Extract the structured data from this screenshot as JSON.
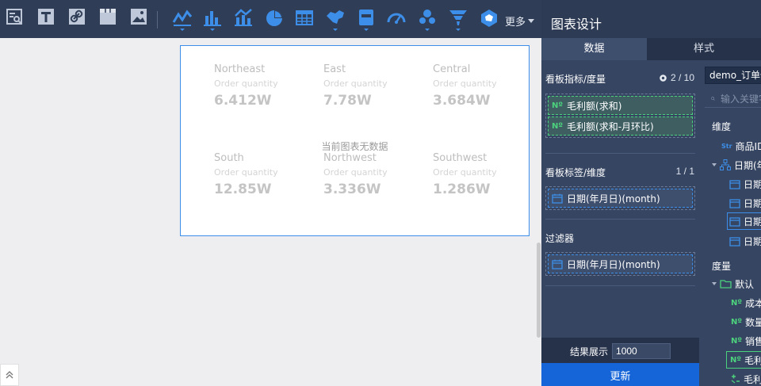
{
  "toolbar": {
    "tools": [
      {
        "id": "query",
        "icon": "query-table-icon",
        "color": "#bfc8d8"
      },
      {
        "id": "text",
        "icon": "text-icon",
        "color": "#bfc8d8"
      },
      {
        "id": "link",
        "icon": "link-icon",
        "color": "#bfc8d8"
      },
      {
        "id": "tab",
        "icon": "tab-icon",
        "color": "#bfc8d8"
      },
      {
        "id": "image",
        "icon": "image-icon",
        "color": "#bfc8d8"
      }
    ],
    "charts": [
      {
        "id": "line",
        "icon": "line-chart-icon"
      },
      {
        "id": "bar",
        "icon": "bar-chart-icon"
      },
      {
        "id": "combo",
        "icon": "combo-chart-icon"
      },
      {
        "id": "pie",
        "icon": "pie-chart-icon"
      },
      {
        "id": "table",
        "icon": "table-chart-icon"
      },
      {
        "id": "map",
        "icon": "map-chart-icon"
      },
      {
        "id": "kpi",
        "icon": "kpi-chart-icon"
      },
      {
        "id": "gauge",
        "icon": "gauge-chart-icon"
      },
      {
        "id": "scatter",
        "icon": "scatter-chart-icon"
      },
      {
        "id": "funnel",
        "icon": "funnel-chart-icon"
      },
      {
        "id": "radar",
        "icon": "radar-chart-icon"
      }
    ],
    "accent": "#3d8ee8",
    "more_label": "更多"
  },
  "canvas": {
    "kpis": [
      {
        "name": "Northeast",
        "sub": "Order quantity",
        "value": "6.412W"
      },
      {
        "name": "East",
        "sub": "Order quantity",
        "value": "7.78W"
      },
      {
        "name": "Central",
        "sub": "Order quantity",
        "value": "3.684W"
      },
      {
        "name": "South",
        "sub": "Order quantity",
        "value": "12.85W"
      },
      {
        "name": "Northwest",
        "sub": "Order quantity",
        "value": "3.336W"
      },
      {
        "name": "Southwest",
        "sub": "Order quantity",
        "value": "1.286W"
      }
    ],
    "no_data_text": "当前图表无数据"
  },
  "panel": {
    "title": "图表设计",
    "tabs": {
      "data": "数据",
      "style": "样式"
    },
    "measures": {
      "title": "看板指标/度量",
      "count": "2 / 10",
      "items": [
        "毛利额(求和)",
        "毛利额(求和-月环比)"
      ],
      "number_tag": "Nº"
    },
    "dimensions": {
      "title": "看板标签/维度",
      "count": "1 / 1",
      "items": [
        "日期(年月日)(month)"
      ]
    },
    "filters": {
      "title": "过滤器",
      "items": [
        "日期(年月日)(month)"
      ]
    },
    "result": {
      "label": "结果展示",
      "value": "1000"
    },
    "update_label": "更新",
    "datasource": {
      "selected": "demo_订单信息",
      "search_placeholder": "输入关键字",
      "dimension_title": "维度",
      "measure_title": "度量",
      "str_tag": "Str",
      "dim_fields": [
        "商品ID",
        "日期(年月日)",
        "日期",
        "日期",
        "日期",
        "日期"
      ],
      "measure_folder": "默认",
      "measure_fields": [
        "成本",
        "数量",
        "销售额",
        "毛利额",
        "毛利"
      ]
    }
  }
}
